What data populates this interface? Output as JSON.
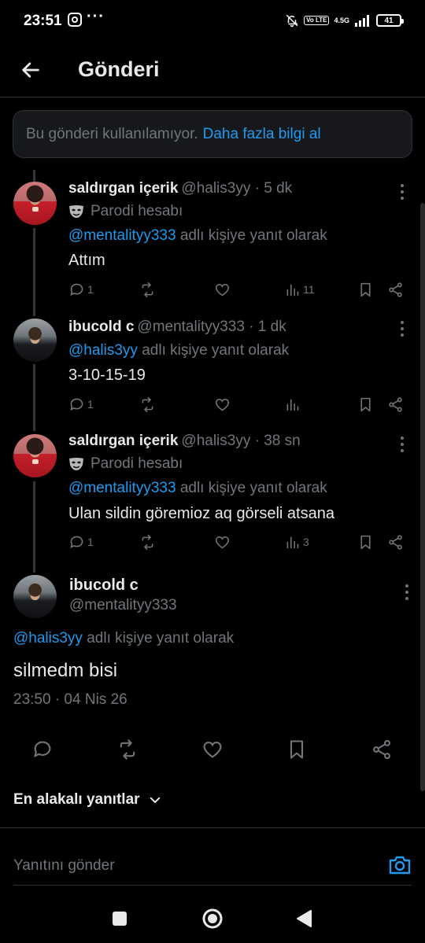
{
  "status_bar": {
    "time": "23:51",
    "dots": "···",
    "volte": "Vo LTE",
    "network": "4.5G",
    "battery": "41"
  },
  "header": {
    "title": "Gönderi"
  },
  "notice": {
    "text": "Bu gönderi kullanılamıyor.",
    "link": "Daha fazla bilgi al"
  },
  "tweets": [
    {
      "name": "saldırgan içerik",
      "handle": "@halis3yy · 5 dk",
      "parody": "Parodi hesabı",
      "reply_mention": "@mentalityy333",
      "reply_suffix": "adlı kişiye yanıt olarak",
      "text": "Attım",
      "replies": "1",
      "views": "11"
    },
    {
      "name": "ibucold c",
      "handle": "@mentalityy333 · 1 dk",
      "reply_mention": "@halis3yy",
      "reply_suffix": "adlı kişiye yanıt olarak",
      "text": "3-10-15-19",
      "replies": "1",
      "views": ""
    },
    {
      "name": "saldırgan içerik",
      "handle": "@halis3yy · 38 sn",
      "parody": "Parodi hesabı",
      "reply_mention": "@mentalityy333",
      "reply_suffix": "adlı kişiye yanıt olarak",
      "text": "Ulan sildin göremioz aq görseli atsana",
      "replies": "1",
      "views": "3"
    }
  ],
  "main_tweet": {
    "name": "ibucold c",
    "handle": "@mentalityy333",
    "reply_mention": "@halis3yy",
    "reply_suffix": "adlı kişiye yanıt olarak",
    "text": "silmedm bisi",
    "timestamp": "23:50 · 04 Nis 26"
  },
  "sort": {
    "label": "En alakalı yanıtlar"
  },
  "composer": {
    "placeholder": "Yanıtını gönder"
  },
  "colors": {
    "accent": "#1d9bf0",
    "muted": "#71767b",
    "text": "#e7e9ea",
    "background": "#000000"
  }
}
